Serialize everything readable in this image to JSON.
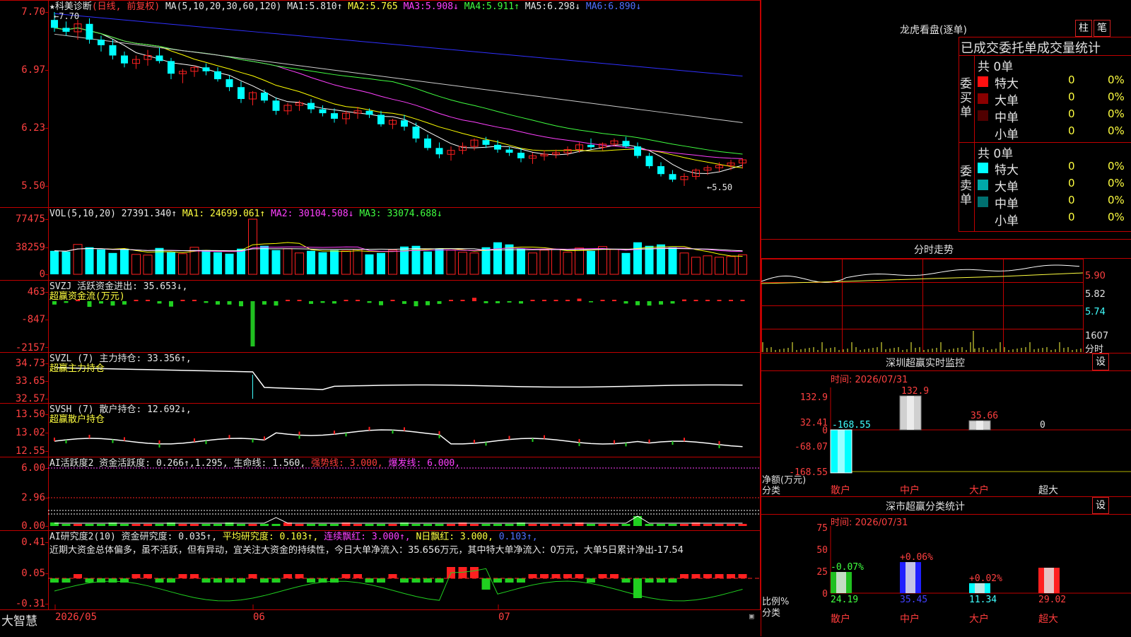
{
  "colors": {
    "up": "#ff2020",
    "down": "#00ffff",
    "grid": "#c00000",
    "ma1": "#ffffff",
    "ma2": "#ffff00",
    "ma3": "#ff40ff",
    "ma4": "#40ff40",
    "ma5": "#cccccc",
    "ma6": "#3030ff"
  },
  "main": {
    "title_prefix": "★",
    "title": "科美诊断",
    "subtitle": "(日线, 前复权)",
    "ma_params": "MA(5,10,20,30,60,120)",
    "ma_values": [
      {
        "label": "MA1:",
        "value": "5.810↑"
      },
      {
        "label": "MA2:",
        "value": "5.765"
      },
      {
        "label": "MA3:",
        "value": "5.908↓"
      },
      {
        "label": "MA4:",
        "value": "5.911↑"
      },
      {
        "label": "MA5:",
        "value": "6.298↓"
      },
      {
        "label": "MA6:",
        "value": "6.890↓"
      }
    ],
    "y_ticks": [
      "7.70",
      "6.97",
      "6.23",
      "5.50"
    ],
    "high_marker": "←7.70",
    "low_marker": "←5.50"
  },
  "vol": {
    "header": "VOL(5,10,20)",
    "value": "27391.340↑",
    "ma1": "MA1: 24699.061↑",
    "ma2": "MA2: 30104.508↓",
    "ma3": "MA3: 33074.688↓",
    "y_ticks": [
      "77475",
      "38259",
      "0"
    ]
  },
  "svzj": {
    "header": "SVZJ  活跃资金进出: 35.653↓,",
    "sub": "超赢资金流(万元)",
    "y_ticks": [
      "463",
      "-847",
      "-2157"
    ]
  },
  "svzl": {
    "header_name": "SVZL (7)",
    "header_value": "主力持仓: 33.356↑,",
    "sub": "超赢主力持仓",
    "y_ticks": [
      "34.73",
      "33.65",
      "32.57"
    ]
  },
  "svsh": {
    "header_name": "SVSH (7)",
    "header_value": "散户持仓: 12.692↓,",
    "sub": "超赢散户持仓",
    "y_ticks": [
      "13.50",
      "13.02",
      "12.55"
    ]
  },
  "ai_activity": {
    "header_a": "AI活跃度2 资金活跃度: 0.266↑,1.295,",
    "header_b": "生命线: 1.560,",
    "header_c": "强势线: 3.000,",
    "header_d": "爆发线: 6.000,",
    "y_ticks": [
      "6.00",
      "2.96",
      "0.00"
    ]
  },
  "ai_research": {
    "header_a": "AI研究度2(10) 资金研究度: 0.035↑,",
    "header_b": "平均研究度: 0.103↑,",
    "header_c": "连续飘红: 3.000↑,",
    "header_d": "N日飘红: 3.000,",
    "header_e": "0.103↑,",
    "comment": "近期大资金总体偏多，虽不活跃，但有异动，宜关注大资金的持续性，今日大单净流入：35.656万元，其中特大单净流入：0万元，大单5日累计净出-17.54",
    "y_ticks": [
      "0.41",
      "0.05",
      "-0.31"
    ]
  },
  "x_axis": {
    "labels": [
      "2026/05",
      "06",
      "07"
    ]
  },
  "brand": "大智慧",
  "panel_lhb": {
    "title": "龙虎看盘(逐单)",
    "btn_bar": "柱",
    "btn_pen": "笔",
    "subtitle": "已成交委托单成交量统计",
    "buy_label": "委买单",
    "sell_label": "委卖单",
    "buy_total": "共 0单",
    "sell_total": "共 0单",
    "buy_rows": [
      {
        "name": "特大",
        "count": "0",
        "pct": "0%",
        "color": "#ff1010"
      },
      {
        "name": "大单",
        "count": "0",
        "pct": "0%",
        "color": "#8a0000"
      },
      {
        "name": "中单",
        "count": "0",
        "pct": "0%",
        "color": "#500000"
      },
      {
        "name": "小单",
        "count": "0",
        "pct": "0%",
        "color": "#000000"
      }
    ],
    "sell_rows": [
      {
        "name": "特大",
        "count": "0",
        "pct": "0%",
        "color": "#00ffff"
      },
      {
        "name": "大单",
        "count": "0",
        "pct": "0%",
        "color": "#00a8a8"
      },
      {
        "name": "中单",
        "count": "0",
        "pct": "0%",
        "color": "#007070"
      },
      {
        "name": "小单",
        "count": "0",
        "pct": "0%",
        "color": "#000000"
      }
    ]
  },
  "panel_intraday": {
    "title": "分时走势",
    "y_ticks": [
      "5.90",
      "5.82",
      "5.74"
    ],
    "vol_tick": "1607",
    "vol_label": "分时"
  },
  "panel_sz_monitor": {
    "title": "深圳超赢实时监控",
    "btn": "设",
    "time": "时间: 2026/07/31",
    "y_ticks": [
      "132.9",
      "32.41",
      "0",
      "-68.07",
      "-168.55"
    ],
    "y_label": "净额(万元)",
    "x_label": "分类",
    "categories": [
      "散户",
      "中户",
      "大户",
      "超大"
    ],
    "values": [
      -168.55,
      132.9,
      35.66,
      0
    ],
    "value_labels": [
      "-168.55",
      "132.9",
      "35.66",
      "0"
    ]
  },
  "panel_sz_class": {
    "title": "深市超赢分类统计",
    "btn": "设",
    "time": "时间: 2026/07/31",
    "y_ticks": [
      "75",
      "50",
      "25",
      "0"
    ],
    "y_label": "比例%",
    "x_label": "分类",
    "categories": [
      "散户",
      "中户",
      "大户",
      "超大"
    ],
    "values": [
      24.19,
      35.45,
      11.34,
      29.02
    ],
    "value_labels": [
      "24.19",
      "35.45",
      "11.34",
      "29.02"
    ],
    "change_labels": [
      "-0.07%",
      "+0.06%",
      "+0.02%",
      ""
    ]
  },
  "chart_data": [
    {
      "type": "candlestick",
      "title": "科美诊断 (日线, 前复权)",
      "ylim": [
        5.5,
        7.7
      ],
      "x": [
        "2026/05",
        "06",
        "07"
      ],
      "ohlc": [
        [
          7.6,
          7.7,
          7.45,
          7.5
        ],
        [
          7.5,
          7.58,
          7.4,
          7.45
        ],
        [
          7.45,
          7.6,
          7.35,
          7.55
        ],
        [
          7.55,
          7.62,
          7.3,
          7.35
        ],
        [
          7.35,
          7.4,
          7.2,
          7.28
        ],
        [
          7.28,
          7.35,
          7.1,
          7.15
        ],
        [
          7.15,
          7.2,
          7.0,
          7.05
        ],
        [
          7.05,
          7.15,
          6.98,
          7.1
        ],
        [
          7.1,
          7.22,
          7.02,
          7.15
        ],
        [
          7.15,
          7.25,
          7.05,
          7.08
        ],
        [
          7.08,
          7.12,
          6.85,
          6.92
        ],
        [
          6.92,
          6.98,
          6.8,
          6.95
        ],
        [
          6.95,
          7.02,
          6.88,
          7.0
        ],
        [
          7.0,
          7.05,
          6.9,
          6.95
        ],
        [
          6.95,
          7.0,
          6.82,
          6.85
        ],
        [
          6.85,
          6.9,
          6.7,
          6.75
        ],
        [
          6.75,
          6.82,
          6.55,
          6.6
        ],
        [
          6.6,
          6.7,
          6.52,
          6.68
        ],
        [
          6.68,
          6.72,
          6.55,
          6.58
        ],
        [
          6.58,
          6.62,
          6.4,
          6.45
        ],
        [
          6.45,
          6.55,
          6.4,
          6.52
        ],
        [
          6.52,
          6.58,
          6.45,
          6.55
        ],
        [
          6.55,
          6.6,
          6.42,
          6.47
        ],
        [
          6.47,
          6.52,
          6.38,
          6.42
        ],
        [
          6.42,
          6.48,
          6.3,
          6.35
        ],
        [
          6.35,
          6.45,
          6.28,
          6.42
        ],
        [
          6.42,
          6.5,
          6.35,
          6.45
        ],
        [
          6.45,
          6.48,
          6.36,
          6.4
        ],
        [
          6.4,
          6.45,
          6.25,
          6.28
        ],
        [
          6.28,
          6.35,
          6.22,
          6.33
        ],
        [
          6.33,
          6.4,
          6.2,
          6.25
        ],
        [
          6.25,
          6.3,
          6.05,
          6.1
        ],
        [
          6.1,
          6.15,
          5.95,
          5.98
        ],
        [
          5.98,
          6.05,
          5.85,
          5.9
        ],
        [
          5.9,
          6.0,
          5.82,
          5.95
        ],
        [
          5.95,
          6.05,
          5.9,
          6.0
        ],
        [
          6.0,
          6.1,
          5.95,
          6.08
        ],
        [
          6.08,
          6.12,
          5.98,
          6.02
        ],
        [
          6.02,
          6.08,
          5.92,
          5.96
        ],
        [
          5.96,
          6.0,
          5.88,
          5.92
        ],
        [
          5.92,
          5.98,
          5.8,
          5.85
        ],
        [
          5.85,
          5.92,
          5.78,
          5.88
        ],
        [
          5.88,
          5.95,
          5.82,
          5.9
        ],
        [
          5.9,
          5.96,
          5.85,
          5.92
        ],
        [
          5.92,
          6.0,
          5.88,
          5.96
        ],
        [
          5.96,
          6.05,
          5.92,
          6.02
        ],
        [
          6.02,
          6.1,
          5.96,
          5.99
        ],
        [
          5.99,
          6.05,
          5.95,
          6.03
        ],
        [
          6.03,
          6.1,
          6.0,
          6.07
        ],
        [
          6.07,
          6.12,
          5.98,
          6.0
        ],
        [
          6.0,
          6.05,
          5.85,
          5.88
        ],
        [
          5.88,
          5.92,
          5.72,
          5.75
        ],
        [
          5.75,
          5.8,
          5.62,
          5.65
        ],
        [
          5.65,
          5.7,
          5.55,
          5.58
        ],
        [
          5.58,
          5.66,
          5.5,
          5.62
        ],
        [
          5.62,
          5.72,
          5.58,
          5.7
        ],
        [
          5.7,
          5.76,
          5.64,
          5.73
        ],
        [
          5.73,
          5.8,
          5.68,
          5.76
        ],
        [
          5.76,
          5.83,
          5.7,
          5.79
        ],
        [
          5.79,
          5.85,
          5.72,
          5.83
        ]
      ]
    },
    {
      "type": "bar",
      "title": "VOL(5,10,20)",
      "ylim": [
        0,
        77475
      ],
      "values": [
        33000,
        32000,
        42000,
        38000,
        35000,
        30000,
        36000,
        28000,
        27000,
        37000,
        31000,
        29000,
        38000,
        34000,
        31000,
        29000,
        36000,
        77475,
        40000,
        34000,
        36000,
        30000,
        33000,
        31000,
        34000,
        33000,
        35000,
        28000,
        30000,
        34000,
        39000,
        40000,
        32000,
        36000,
        34000,
        31000,
        30000,
        38000,
        45000,
        42000,
        36000,
        30000,
        34000,
        35000,
        31000,
        37000,
        33000,
        39000,
        35000,
        30000,
        45000,
        40000,
        42000,
        38000,
        30000,
        24000,
        26000,
        24000,
        25000,
        27391
      ]
    }
  ]
}
